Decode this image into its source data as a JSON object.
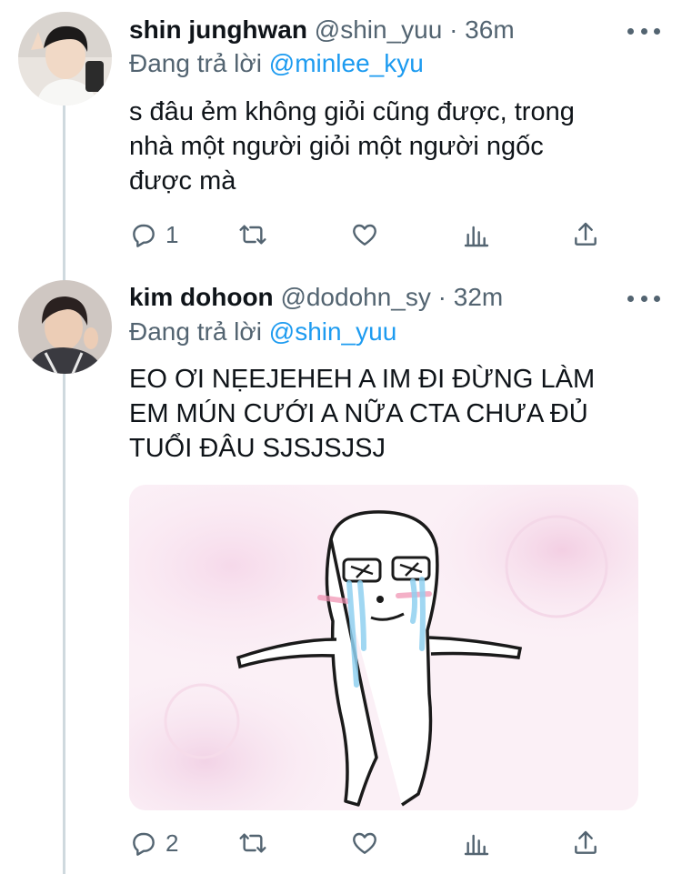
{
  "tweets": [
    {
      "name": "shin junghwan",
      "handle": "@shin_yuu",
      "time": "· 36m",
      "replying_prefix": "Đang trả lời",
      "replying_to": "@minlee_kyu",
      "text_lines": [
        "s đâu ẻm không giỏi cũng được, trong",
        "nhà một người giỏi một người ngốc",
        "được mà"
      ],
      "reply_count": "1",
      "avatar": "profile-photo"
    },
    {
      "name": "kim dohoon",
      "handle": "@dodohn_sy",
      "time": "· 32m",
      "replying_prefix": "Đang trả lời",
      "replying_to": "@shin_yuu",
      "text_lines": [
        "EO ƠI NẸEJEHEH A IM ĐI ĐỪNG LÀM",
        "EM MÚN CƯỚI A NỮA CTA CHƯA ĐỦ",
        "TUỔI ĐÂU SJSJSJSJ"
      ],
      "reply_count": "2",
      "avatar": "profile-photo",
      "media": "crying-cartoon-meme"
    }
  ],
  "icons": {
    "more": "more-icon",
    "reply": "reply-icon",
    "retweet": "retweet-icon",
    "like": "like-icon",
    "analytics": "analytics-icon",
    "share": "share-icon"
  },
  "colors": {
    "accent": "#1d9bf0",
    "secondary": "#536471",
    "line": "#cfd9de"
  }
}
